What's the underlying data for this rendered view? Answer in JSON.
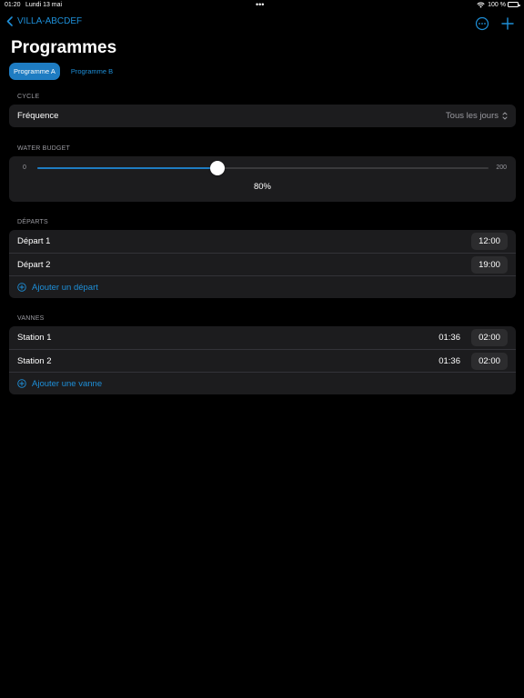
{
  "status_bar": {
    "time": "01:20",
    "date": "Lundi 13 mai",
    "dots": "•••",
    "battery": "100 %"
  },
  "nav": {
    "back_label": "VILLA-ABCDEF"
  },
  "page_title": "Programmes",
  "tabs": [
    {
      "label": "Programme A",
      "active": true
    },
    {
      "label": "Programme B",
      "active": false
    }
  ],
  "cycle": {
    "section_title": "CYCLE",
    "frequency_label": "Fréquence",
    "frequency_value": "Tous les jours"
  },
  "water_budget": {
    "section_title": "WATER BUDGET",
    "min": "0",
    "max": "200",
    "value": 80,
    "value_label": "80%"
  },
  "departs": {
    "section_title": "DÉPARTS",
    "items": [
      {
        "label": "Départ 1",
        "time": "12:00"
      },
      {
        "label": "Départ 2",
        "time": "19:00"
      }
    ],
    "add_label": "Ajouter un départ"
  },
  "vannes": {
    "section_title": "VANNES",
    "items": [
      {
        "label": "Station 1",
        "duration": "01:36",
        "time": "02:00"
      },
      {
        "label": "Station 2",
        "duration": "01:36",
        "time": "02:00"
      }
    ],
    "add_label": "Ajouter une vanne"
  },
  "colors": {
    "accent": "#1e8fd8",
    "active_tab": "#1e7cc2",
    "card": "#1c1c1e",
    "background": "#000000"
  }
}
